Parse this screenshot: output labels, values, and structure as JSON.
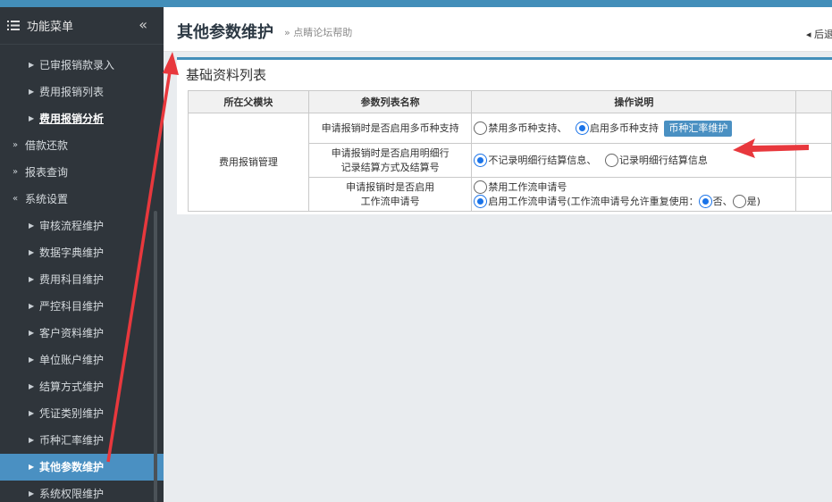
{
  "sidebar": {
    "header_title": "功能菜单",
    "collapse_icon": "double-chevron-left-icon",
    "items": [
      {
        "label": "已审报销款录入"
      },
      {
        "label": "费用报销列表"
      },
      {
        "label": "费用报销分析"
      },
      {
        "label": "借款还款"
      },
      {
        "label": "报表查询"
      },
      {
        "label": "系统设置"
      },
      {
        "label": "审核流程维护"
      },
      {
        "label": "数据字典维护"
      },
      {
        "label": "费用科目维护"
      },
      {
        "label": "严控科目维护"
      },
      {
        "label": "客户资料维护"
      },
      {
        "label": "单位账户维护"
      },
      {
        "label": "结算方式维护"
      },
      {
        "label": "凭证类别维护"
      },
      {
        "label": "币种汇率维护"
      },
      {
        "label": "其他参数维护"
      },
      {
        "label": "系统权限维护"
      }
    ]
  },
  "header": {
    "title": "其他参数维护",
    "help_link": "» 点睛论坛帮助",
    "back_link": "◂ 后退"
  },
  "panel": {
    "title": "基础资料列表",
    "columns": [
      "所在父模块",
      "参数列表名称",
      "操作说明",
      ""
    ],
    "module": "费用报销管理",
    "rows": [
      {
        "name": "申请报销时是否启用多币种支持",
        "opt1": "禁用多币种支持、",
        "opt2": "启用多币种支持",
        "button": "币种汇率维护"
      },
      {
        "name_line1": "申请报销时是否启用明细行",
        "name_line2": "记录结算方式及结算号",
        "opt1": "不记录明细行结算信息、",
        "opt2": "记录明细行结算信息"
      },
      {
        "name_line1": "申请报销时是否启用",
        "name_line2": "工作流申请号",
        "opt1": "禁用工作流申请号",
        "opt2": "启用工作流申请号(工作流申请号允许重复使用：",
        "opt3": "否、",
        "opt4": "是)"
      }
    ]
  },
  "colors": {
    "accent": "#438eb9",
    "sidebar_bg": "#2f353b",
    "active": "#4a90c2",
    "arrow": "#e8383d"
  }
}
